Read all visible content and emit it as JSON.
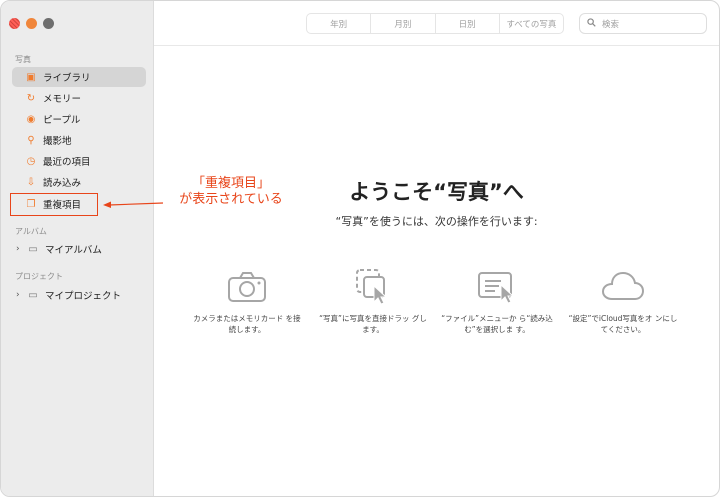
{
  "sidebar": {
    "photos_header": "写真",
    "items": [
      {
        "label": "ライブラリ",
        "icon": "library-icon"
      },
      {
        "label": "メモリー",
        "icon": "memories-icon"
      },
      {
        "label": "ピープル",
        "icon": "people-icon"
      },
      {
        "label": "撮影地",
        "icon": "places-icon"
      },
      {
        "label": "最近の項目",
        "icon": "recents-icon"
      },
      {
        "label": "読み込み",
        "icon": "imports-icon"
      },
      {
        "label": "重複項目",
        "icon": "duplicates-icon"
      }
    ],
    "albums_header": "アルバム",
    "my_albums": "マイアルバム",
    "projects_header": "プロジェクト",
    "my_projects": "マイプロジェクト"
  },
  "toolbar": {
    "tabs": [
      "年別",
      "月別",
      "日別",
      "すべての写真"
    ],
    "search_placeholder": "検索"
  },
  "annotation": {
    "line1": "「重複項目」",
    "line2": "が表示されている",
    "color": "#e8451a"
  },
  "welcome": {
    "title": "ようこそ“写真”へ",
    "subtitle": "“写真”を使うには、次の操作を行います:",
    "features": [
      {
        "icon": "camera-icon",
        "text": "カメラまたはメモリカード を接続します。"
      },
      {
        "icon": "drag-icon",
        "text": "“写真”に写真を直接ドラッ グします。"
      },
      {
        "icon": "file-menu-icon",
        "text": "“ファイル”メニューか ら“読み込む”を選択しま す。"
      },
      {
        "icon": "icloud-icon",
        "text": "“設定”でiCloud写真をオ ンにしてください。"
      }
    ]
  },
  "accent_color": "#f07b2d"
}
